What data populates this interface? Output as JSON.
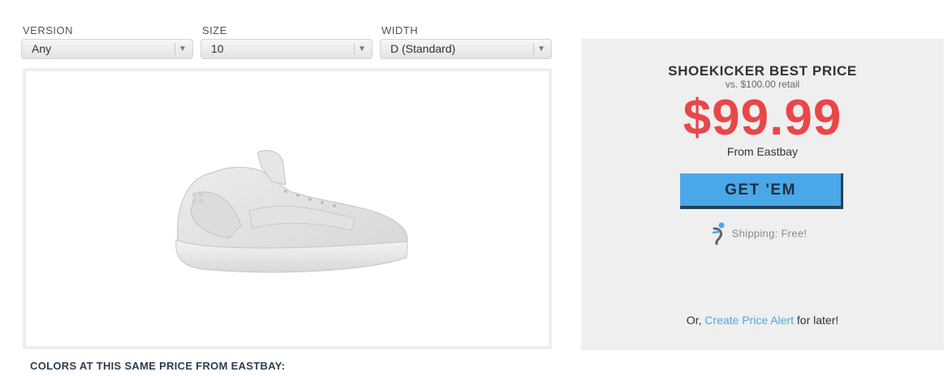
{
  "filters": {
    "version": {
      "label": "VERSION",
      "value": "Any"
    },
    "size": {
      "label": "SIZE",
      "value": "10"
    },
    "width": {
      "label": "WIDTH",
      "value": "D (Standard)"
    }
  },
  "product": {
    "image_icon": "white-sneaker-image"
  },
  "colors_heading": "COLORS AT THIS SAME PRICE FROM EASTBAY:",
  "price_panel": {
    "title": "SHOEKICKER BEST PRICE",
    "retail": "vs. $100.00 retail",
    "price": "$99.99",
    "from": "From Eastbay",
    "button_label": "GET 'EM",
    "shipping_icon": "shipping-logo-icon",
    "shipping_text": "Shipping: Free!",
    "alert_prefix": "Or,",
    "alert_link": "Create Price Alert",
    "alert_suffix": "for later!"
  },
  "colors": {
    "accent": "#4aa8e8",
    "price": "#e8474a",
    "panel_bg": "#efefef"
  }
}
